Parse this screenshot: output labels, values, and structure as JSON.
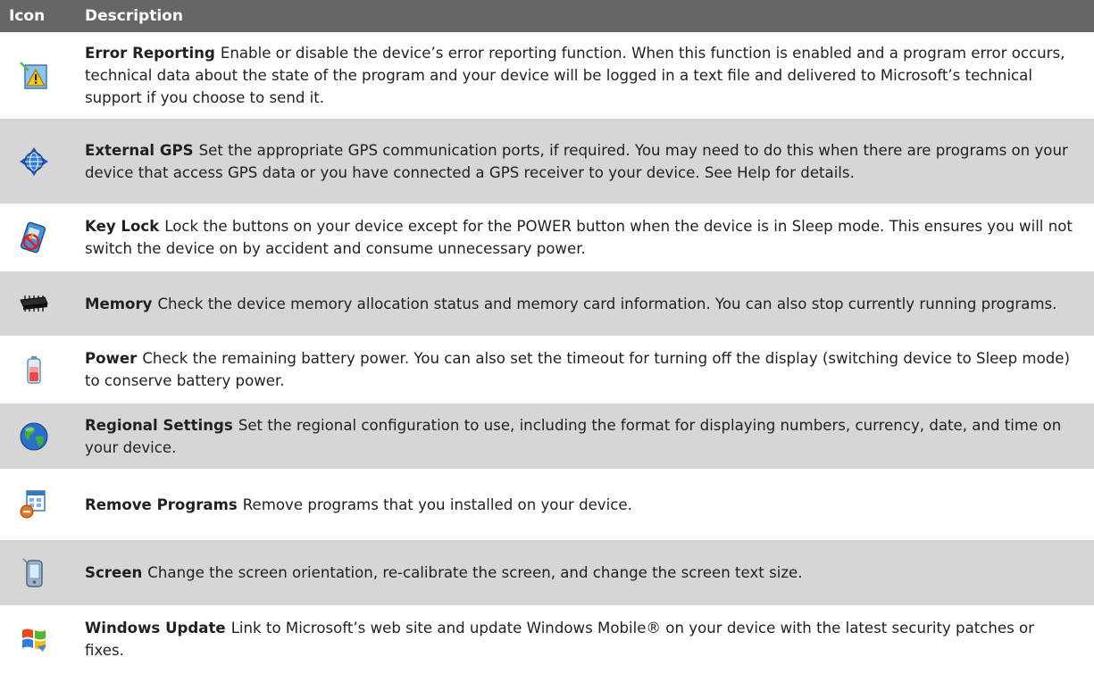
{
  "header": {
    "icon": "Icon",
    "description": "Description"
  },
  "rows": [
    {
      "icon": "error-reporting-icon",
      "name": "Error Reporting",
      "text": "Enable or disable the device’s error reporting function. When this function is enabled and a program error occurs, technical data about the state of the program and your device will be logged in a text file and delivered to Microsoft’s technical support if you choose to send it."
    },
    {
      "icon": "external-gps-icon",
      "name": "External GPS",
      "text": "Set the appropriate GPS communication ports, if required. You may need to do this when there are programs on your device that access GPS data or you have connected a GPS receiver to your device. See Help for details."
    },
    {
      "icon": "key-lock-icon",
      "name": "Key Lock",
      "text": "Lock the buttons on your device except for the POWER button when the device is in Sleep mode. This ensures you will not switch the device on by accident and consume unnecessary power."
    },
    {
      "icon": "memory-chip-icon",
      "name": "Memory",
      "text": "Check the device memory allocation status and memory card information. You can also stop currently running programs."
    },
    {
      "icon": "battery-icon",
      "name": "Power",
      "text": "Check the remaining battery power. You can also set the timeout for turning off the display (switching device to Sleep mode) to conserve battery power."
    },
    {
      "icon": "globe-icon",
      "name": "Regional Settings",
      "text": "Set the regional configuration to use, including the format for displaying numbers, currency, date, and time on your device."
    },
    {
      "icon": "remove-programs-icon",
      "name": "Remove Programs",
      "text": "Remove programs that you installed on your device."
    },
    {
      "icon": "screen-icon",
      "name": "Screen",
      "text": "Change the screen orientation, re-calibrate the screen, and change the screen text size."
    },
    {
      "icon": "windows-update-icon",
      "name": "Windows Update",
      "text": "Link to Microsoft’s web site and update Windows Mobile® on your device with the latest security patches or fixes."
    }
  ]
}
